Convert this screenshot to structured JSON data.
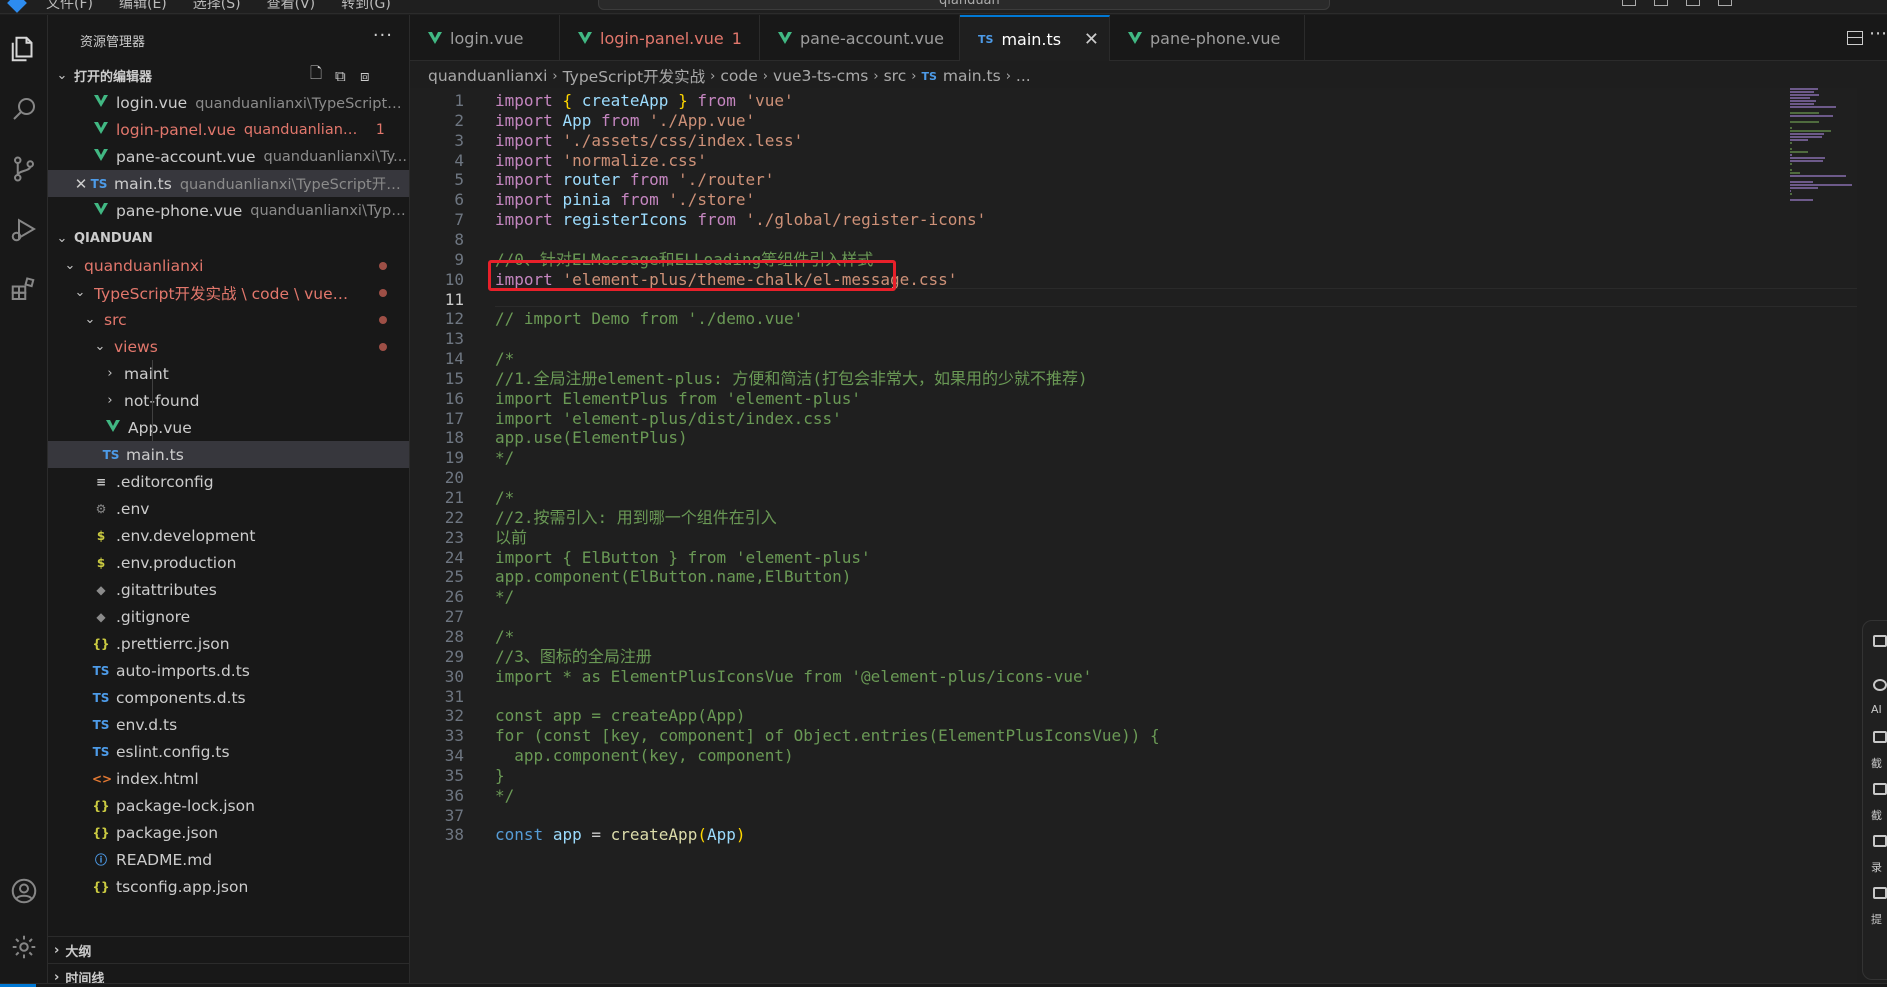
{
  "titlebar": {
    "menu": [
      "文件(F)",
      "编辑(E)",
      "选择(S)",
      "查看(V)",
      "转到(G)"
    ],
    "search_text": "qianduan"
  },
  "sidebar": {
    "title": "资源管理器",
    "more": "···",
    "open_editors": {
      "header": "打开的编辑器",
      "items": [
        {
          "name": "login.vue",
          "desc": "quanduanlianxi\\TypeScript开...",
          "type": "vue"
        },
        {
          "name": "login-panel.vue",
          "desc": "quanduanlianxi\\...",
          "type": "vue",
          "badge": "1"
        },
        {
          "name": "pane-account.vue",
          "desc": "quanduanlianxi\\Ty...",
          "type": "vue"
        },
        {
          "name": "main.ts",
          "desc": "quanduanlianxi\\TypeScript开发...",
          "type": "ts"
        },
        {
          "name": "pane-phone.vue",
          "desc": "quanduanlianxi\\Type...",
          "type": "vue"
        }
      ]
    },
    "workspace": {
      "header": "QIANDUAN",
      "folders": [
        {
          "name": "quanduanlianxi"
        },
        {
          "name": "TypeScript开发实战 \\ code \\ vue3-t..."
        },
        {
          "name": "src"
        },
        {
          "name": "views"
        },
        {
          "name": "maint"
        },
        {
          "name": "not-found"
        }
      ],
      "files": [
        {
          "name": "App.vue",
          "icon": "V"
        },
        {
          "name": "main.ts",
          "icon": "TS"
        },
        {
          "name": ".editorconfig",
          "icon": "≡"
        },
        {
          "name": ".env",
          "icon": "⚙"
        },
        {
          "name": ".env.development",
          "icon": "$"
        },
        {
          "name": ".env.production",
          "icon": "$"
        },
        {
          "name": ".gitattributes",
          "icon": "◆"
        },
        {
          "name": ".gitignore",
          "icon": "◆"
        },
        {
          "name": ".prettierrc.json",
          "icon": "{}"
        },
        {
          "name": "auto-imports.d.ts",
          "icon": "TS"
        },
        {
          "name": "components.d.ts",
          "icon": "TS"
        },
        {
          "name": "env.d.ts",
          "icon": "TS"
        },
        {
          "name": "eslint.config.ts",
          "icon": "TS"
        },
        {
          "name": "index.html",
          "icon": "<>"
        },
        {
          "name": "package-lock.json",
          "icon": "{}"
        },
        {
          "name": "package.json",
          "icon": "{}"
        },
        {
          "name": "README.md",
          "icon": "ⓘ"
        },
        {
          "name": "tsconfig.app.json",
          "icon": "{}"
        }
      ]
    },
    "outline": "大纲",
    "timeline": "时间线"
  },
  "tabs": [
    {
      "label": "login.vue",
      "icon": "V"
    },
    {
      "label": "login-panel.vue",
      "badge": "1",
      "icon": "V"
    },
    {
      "label": "pane-account.vue",
      "icon": "V"
    },
    {
      "label": "main.ts",
      "icon": "TS",
      "close": "✕"
    },
    {
      "label": "pane-phone.vue",
      "icon": "V"
    }
  ],
  "breadcrumb": [
    "quanduanlianxi",
    "TypeScript开发实战",
    "code",
    "vue3-ts-cms",
    "src",
    "TS",
    "main.ts",
    "..."
  ],
  "editor": {
    "current_line": 11,
    "lines": [
      "import { createApp } from 'vue'",
      "import App from './App.vue'",
      "import './assets/css/index.less'",
      "import 'normalize.css'",
      "import router from './router'",
      "import pinia from './store'",
      "import registerIcons from './global/register-icons'",
      "",
      "//0、针对ELMessage和ELLoading等组件引入样式",
      "import 'element-plus/theme-chalk/el-message.css'",
      "",
      "// import Demo from './demo.vue'",
      "",
      "/*",
      "//1.全局注册element-plus: 方便和简洁(打包会非常大，如果用的少就不推荐)",
      "import ElementPlus from 'element-plus'",
      "import 'element-plus/dist/index.css'",
      "app.use(ElementPlus)",
      "*/",
      "",
      "/*",
      "//2.按需引入: 用到哪一个组件在引入",
      "以前",
      "import { ElButton } from 'element-plus'",
      "app.component(ElButton.name,ElButton)",
      "*/",
      "",
      "/*",
      "//3、图标的全局注册",
      "import * as ElementPlusIconsVue from '@element-plus/icons-vue'",
      "",
      "const app = createApp(App)",
      "for (const [key, component] of Object.entries(ElementPlusIconsVue)) {",
      "  app.component(key, component)",
      "}",
      "*/",
      "",
      "const app = createApp(App)"
    ]
  },
  "float_panel": [
    "AI",
    "截",
    "截",
    "录",
    "提"
  ],
  "colors": {
    "accent": "#0078d4",
    "highlight_box": "#e8202a",
    "error_text": "#e2776c",
    "vue_green": "#41b883",
    "ts_blue": "#4d9be8"
  }
}
